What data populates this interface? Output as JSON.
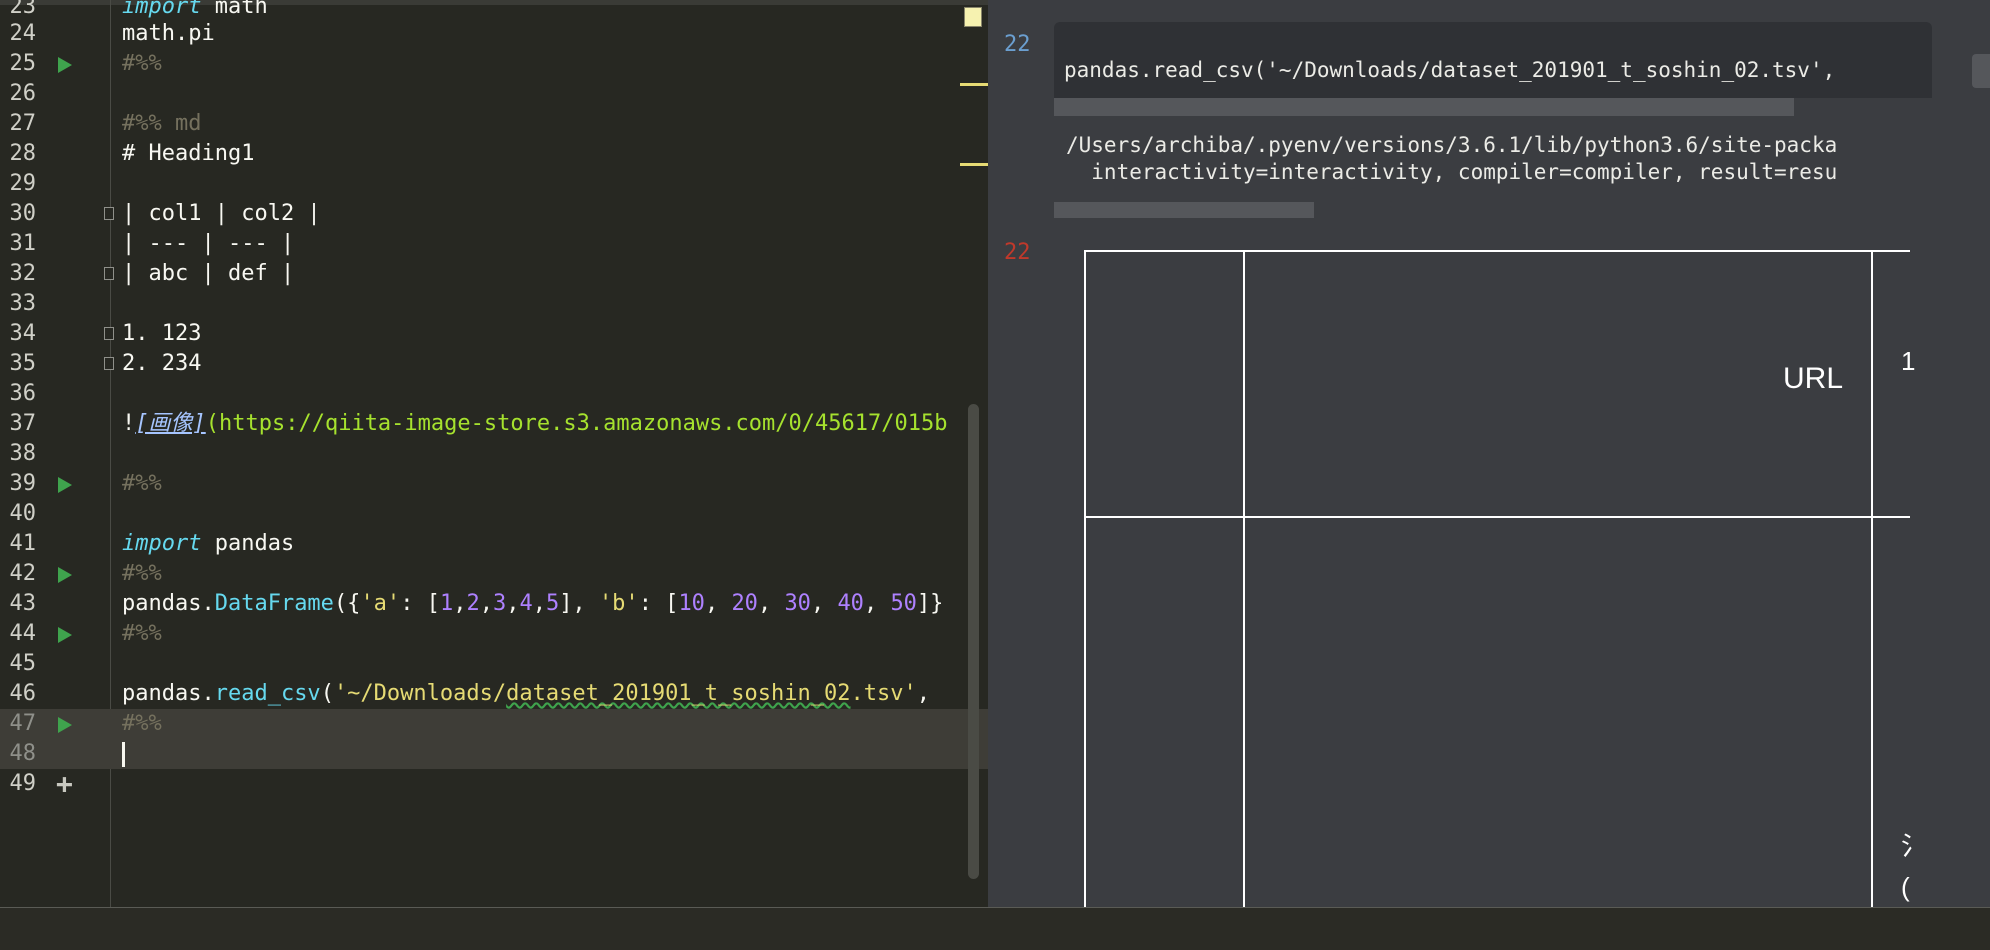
{
  "editor": {
    "lines": [
      {
        "num": "23",
        "code": "import math"
      },
      {
        "num": "24",
        "code": "math.pi"
      },
      {
        "num": "25",
        "code": "#%%"
      },
      {
        "num": "26",
        "code": ""
      },
      {
        "num": "27",
        "code": "#%% md"
      },
      {
        "num": "28",
        "code": "# Heading1"
      },
      {
        "num": "29",
        "code": ""
      },
      {
        "num": "30",
        "code": "| col1 | col2 |"
      },
      {
        "num": "31",
        "code": "| --- | --- |"
      },
      {
        "num": "32",
        "code": "| abc | def |"
      },
      {
        "num": "33",
        "code": ""
      },
      {
        "num": "34",
        "code": "1. 123"
      },
      {
        "num": "35",
        "code": "2. 234"
      },
      {
        "num": "36",
        "code": ""
      },
      {
        "num": "37",
        "code": "![画像](https://qiita-image-store.s3.amazonaws.com/0/45617/015b"
      },
      {
        "num": "38",
        "code": ""
      },
      {
        "num": "39",
        "code": "#%%"
      },
      {
        "num": "40",
        "code": ""
      },
      {
        "num": "41",
        "code": "import pandas"
      },
      {
        "num": "42",
        "code": "#%%"
      },
      {
        "num": "43",
        "code": "pandas.DataFrame({'a': [1,2,3,4,5], 'b': [10, 20, 30, 40, 50]}"
      },
      {
        "num": "44",
        "code": "#%%"
      },
      {
        "num": "45",
        "code": ""
      },
      {
        "num": "46",
        "code": "pandas.read_csv('~/Downloads/dataset_201901_t_soshin_02.tsv',"
      },
      {
        "num": "47",
        "code": "#%%"
      },
      {
        "num": "48",
        "code": ""
      },
      {
        "num": "49",
        "code": ""
      }
    ],
    "run_icon": "play-triangle-icon",
    "add_icon": "plus-icon",
    "colors": {
      "run": "#3fa34d",
      "background": "#272822",
      "keyword": "#66d9ef",
      "string": "#e6db74",
      "number": "#ae81ff",
      "comment": "#75715e"
    }
  },
  "output": {
    "input_exec_count": "22",
    "input_code": "pandas.read_csv('~/Downloads/dataset_201901_t_soshin_02.tsv',",
    "stderr_lines": [
      "/Users/archiba/.pyenv/versions/3.6.1/lib/python3.6/site-packa",
      "  interactivity=interactivity, compiler=compiler, result=resu"
    ],
    "output_exec_count": "22",
    "table_header": "URL",
    "cut_glyphs": [
      "1",
      "⺡",
      "("
    ],
    "colors": {
      "input_count": "#6b9fd0",
      "output_count": "#c0392b",
      "background": "#3b3d41"
    }
  }
}
